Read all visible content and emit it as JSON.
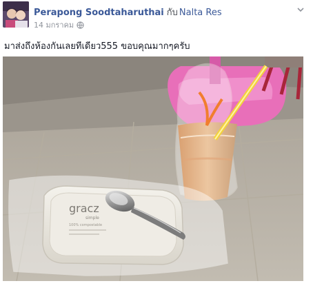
{
  "post": {
    "author": "Perapong Soodtaharuthai",
    "with_word": "กับ",
    "tagged": "Nalta Res",
    "timestamp": "14 มกราคม",
    "caption": "มาส่งถึงห้องกันเลยทีเดียว555 ขอบคุณมากๆครับ"
  },
  "photo": {
    "box_logo_text": "gracz",
    "box_logo_subtext": "simple",
    "box_small_text": "100% compostable"
  },
  "icons": {
    "privacy": "globe-icon",
    "menu": "chevron-down-icon"
  },
  "colors": {
    "link": "#3b5998",
    "meta": "#90949c",
    "text": "#141823"
  }
}
